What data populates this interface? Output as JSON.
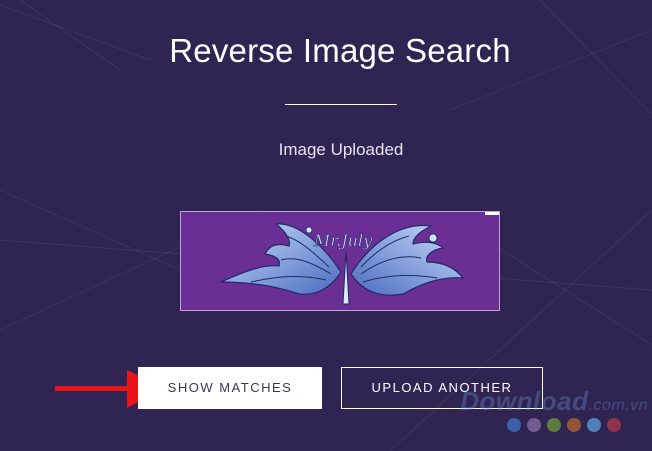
{
  "page": {
    "title": "Reverse Image Search",
    "status": "Image Uploaded"
  },
  "uploaded_image": {
    "caption": "Mr.July"
  },
  "buttons": {
    "show_matches": "SHOW MATCHES",
    "upload_another": "UPLOAD ANOTHER"
  },
  "watermark": {
    "text": "Download",
    "suffix": ".com.vn"
  },
  "colors": {
    "background": "#2f2452",
    "image_background": "#6a2e94",
    "arrow": "#e8141a",
    "dots": [
      "#3f74c8",
      "#8a6ea8",
      "#6f9a3a",
      "#b4652e",
      "#5aa0d8",
      "#b23a4a"
    ]
  }
}
